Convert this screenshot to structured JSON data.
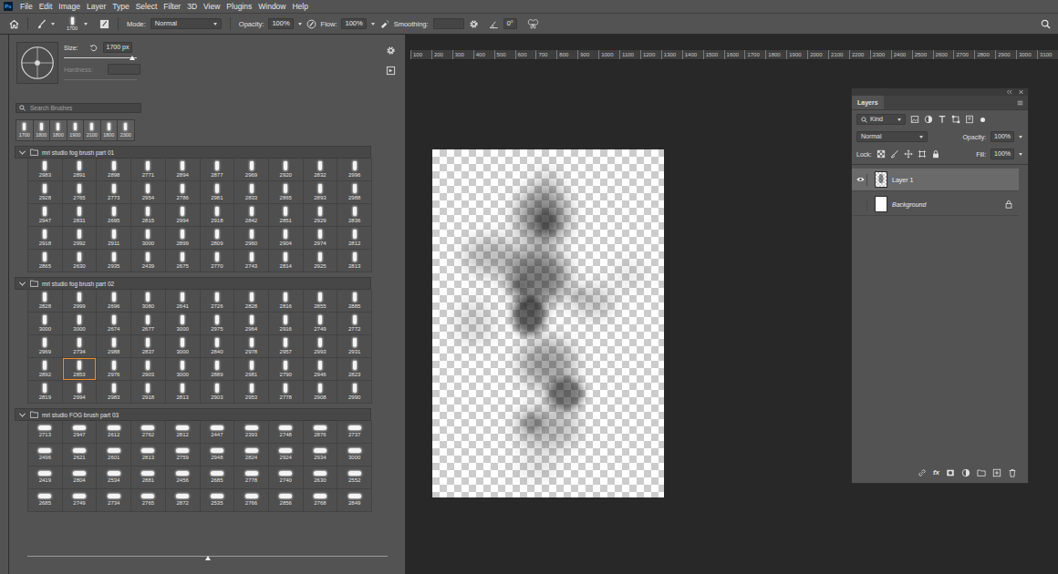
{
  "app": {
    "logo": "Ps"
  },
  "menu": [
    "File",
    "Edit",
    "Image",
    "Layer",
    "Type",
    "Select",
    "Filter",
    "3D",
    "View",
    "Plugins",
    "Window",
    "Help"
  ],
  "options_bar": {
    "brush_size": "1700",
    "mode_label": "Mode:",
    "mode": "Normal",
    "opacity_label": "Opacity:",
    "opacity": "100%",
    "flow_label": "Flow:",
    "flow": "100%",
    "smoothing_label": "Smoothing:",
    "angle": "0°"
  },
  "brush_panel": {
    "size_label": "Size:",
    "size_value": "1700 px",
    "size_level": 0.94,
    "hardness_label": "Hardness:",
    "hardness_disabled": true,
    "search_placeholder": "Search Brushes",
    "recent": [
      {
        "size": "1700",
        "selected": false
      },
      {
        "size": "1800",
        "selected": false
      },
      {
        "size": "1800",
        "selected": false
      },
      {
        "size": "1900",
        "selected": false
      },
      {
        "size": "2100",
        "selected": false
      },
      {
        "size": "1800",
        "selected": false
      },
      {
        "size": "2300",
        "selected": false
      }
    ],
    "groups": [
      {
        "name": "mri studio fog brush part 01",
        "expanded": true,
        "kind": "tall",
        "brushes": [
          {
            "size": "2983",
            "selected": false
          },
          {
            "size": "2891",
            "selected": false
          },
          {
            "size": "2898",
            "selected": false
          },
          {
            "size": "2771",
            "selected": false
          },
          {
            "size": "2894",
            "selected": false
          },
          {
            "size": "2877",
            "selected": false
          },
          {
            "size": "2969",
            "selected": false
          },
          {
            "size": "2920",
            "selected": false
          },
          {
            "size": "2832",
            "selected": false
          },
          {
            "size": "2996",
            "selected": false
          },
          {
            "size": "2928",
            "selected": false
          },
          {
            "size": "2765",
            "selected": false
          },
          {
            "size": "2773",
            "selected": false
          },
          {
            "size": "2954",
            "selected": false
          },
          {
            "size": "2786",
            "selected": false
          },
          {
            "size": "2981",
            "selected": false
          },
          {
            "size": "2833",
            "selected": false
          },
          {
            "size": "2865",
            "selected": false
          },
          {
            "size": "2893",
            "selected": false
          },
          {
            "size": "2988",
            "selected": false
          },
          {
            "size": "2947",
            "selected": false
          },
          {
            "size": "2831",
            "selected": false
          },
          {
            "size": "2695",
            "selected": false
          },
          {
            "size": "2815",
            "selected": false
          },
          {
            "size": "2994",
            "selected": false
          },
          {
            "size": "2918",
            "selected": false
          },
          {
            "size": "2842",
            "selected": false
          },
          {
            "size": "2851",
            "selected": false
          },
          {
            "size": "2929",
            "selected": false
          },
          {
            "size": "2836",
            "selected": false
          },
          {
            "size": "2918",
            "selected": false
          },
          {
            "size": "2992",
            "selected": false
          },
          {
            "size": "2911",
            "selected": false
          },
          {
            "size": "3000",
            "selected": false
          },
          {
            "size": "2899",
            "selected": false
          },
          {
            "size": "2809",
            "selected": false
          },
          {
            "size": "2960",
            "selected": false
          },
          {
            "size": "2904",
            "selected": false
          },
          {
            "size": "2974",
            "selected": false
          },
          {
            "size": "2812",
            "selected": false
          },
          {
            "size": "2865",
            "selected": false
          },
          {
            "size": "2630",
            "selected": false
          },
          {
            "size": "2935",
            "selected": false
          },
          {
            "size": "2439",
            "selected": false
          },
          {
            "size": "2675",
            "selected": false
          },
          {
            "size": "2770",
            "selected": false
          },
          {
            "size": "2743",
            "selected": false
          },
          {
            "size": "2814",
            "selected": false
          },
          {
            "size": "2925",
            "selected": false
          },
          {
            "size": "2813",
            "selected": false
          }
        ]
      },
      {
        "name": "mri studio fog brush part 02",
        "expanded": true,
        "kind": "tall",
        "brushes": [
          {
            "size": "2828",
            "selected": false
          },
          {
            "size": "2999",
            "selected": false
          },
          {
            "size": "2696",
            "selected": false
          },
          {
            "size": "3080",
            "selected": false
          },
          {
            "size": "2641",
            "selected": false
          },
          {
            "size": "2726",
            "selected": false
          },
          {
            "size": "2828",
            "selected": false
          },
          {
            "size": "2816",
            "selected": false
          },
          {
            "size": "2855",
            "selected": false
          },
          {
            "size": "2885",
            "selected": false
          },
          {
            "size": "3000",
            "selected": false
          },
          {
            "size": "3000",
            "selected": false
          },
          {
            "size": "2674",
            "selected": false
          },
          {
            "size": "2677",
            "selected": false
          },
          {
            "size": "3000",
            "selected": false
          },
          {
            "size": "2975",
            "selected": false
          },
          {
            "size": "2964",
            "selected": false
          },
          {
            "size": "2916",
            "selected": false
          },
          {
            "size": "2749",
            "selected": false
          },
          {
            "size": "2772",
            "selected": false
          },
          {
            "size": "2969",
            "selected": false
          },
          {
            "size": "2734",
            "selected": false
          },
          {
            "size": "2988",
            "selected": false
          },
          {
            "size": "2837",
            "selected": false
          },
          {
            "size": "3000",
            "selected": false
          },
          {
            "size": "2840",
            "selected": false
          },
          {
            "size": "2978",
            "selected": false
          },
          {
            "size": "2957",
            "selected": false
          },
          {
            "size": "2993",
            "selected": false
          },
          {
            "size": "2931",
            "selected": false
          },
          {
            "size": "2892",
            "selected": false
          },
          {
            "size": "2853",
            "selected": true
          },
          {
            "size": "2976",
            "selected": false
          },
          {
            "size": "2903",
            "selected": false
          },
          {
            "size": "3000",
            "selected": false
          },
          {
            "size": "2889",
            "selected": false
          },
          {
            "size": "2981",
            "selected": false
          },
          {
            "size": "2790",
            "selected": false
          },
          {
            "size": "2946",
            "selected": false
          },
          {
            "size": "2823",
            "selected": false
          },
          {
            "size": "2819",
            "selected": false
          },
          {
            "size": "2994",
            "selected": false
          },
          {
            "size": "2983",
            "selected": false
          },
          {
            "size": "2918",
            "selected": false
          },
          {
            "size": "2813",
            "selected": false
          },
          {
            "size": "2903",
            "selected": false
          },
          {
            "size": "2953",
            "selected": false
          },
          {
            "size": "2778",
            "selected": false
          },
          {
            "size": "2908",
            "selected": false
          },
          {
            "size": "2990",
            "selected": false
          }
        ]
      },
      {
        "name": "mri studio FOG brush part 03",
        "expanded": true,
        "kind": "wide",
        "brushes": [
          {
            "size": "2713",
            "selected": false
          },
          {
            "size": "2947",
            "selected": false
          },
          {
            "size": "2612",
            "selected": false
          },
          {
            "size": "2762",
            "selected": false
          },
          {
            "size": "2812",
            "selected": false
          },
          {
            "size": "2447",
            "selected": false
          },
          {
            "size": "2393",
            "selected": false
          },
          {
            "size": "2748",
            "selected": false
          },
          {
            "size": "2876",
            "selected": false
          },
          {
            "size": "2737",
            "selected": false
          },
          {
            "size": "2496",
            "selected": false
          },
          {
            "size": "2621",
            "selected": false
          },
          {
            "size": "2601",
            "selected": false
          },
          {
            "size": "2813",
            "selected": false
          },
          {
            "size": "2759",
            "selected": false
          },
          {
            "size": "2948",
            "selected": false
          },
          {
            "size": "2824",
            "selected": false
          },
          {
            "size": "2924",
            "selected": false
          },
          {
            "size": "2934",
            "selected": false
          },
          {
            "size": "3000",
            "selected": false
          },
          {
            "size": "2419",
            "selected": false
          },
          {
            "size": "2804",
            "selected": false
          },
          {
            "size": "2534",
            "selected": false
          },
          {
            "size": "2881",
            "selected": false
          },
          {
            "size": "2456",
            "selected": false
          },
          {
            "size": "2685",
            "selected": false
          },
          {
            "size": "2778",
            "selected": false
          },
          {
            "size": "2740",
            "selected": false
          },
          {
            "size": "2630",
            "selected": false
          },
          {
            "size": "2552",
            "selected": false
          },
          {
            "size": "2685",
            "selected": false
          },
          {
            "size": "2749",
            "selected": false
          },
          {
            "size": "2734",
            "selected": false
          },
          {
            "size": "2765",
            "selected": false
          },
          {
            "size": "2872",
            "selected": false
          },
          {
            "size": "2535",
            "selected": false
          },
          {
            "size": "2766",
            "selected": false
          },
          {
            "size": "2856",
            "selected": false
          },
          {
            "size": "2768",
            "selected": false
          },
          {
            "size": "2849",
            "selected": false
          }
        ]
      }
    ],
    "thumb_size_level": 0.5
  },
  "ruler": [
    "100",
    "200",
    "300",
    "400",
    "500",
    "600",
    "700",
    "800",
    "900",
    "1000",
    "1100",
    "1200",
    "1300",
    "1400",
    "1500",
    "1600",
    "1700",
    "1800",
    "1900",
    "2000",
    "2100",
    "2200",
    "2300",
    "2400",
    "2500",
    "2600",
    "2700",
    "2800",
    "2900",
    "3000",
    "3100"
  ],
  "layers_panel": {
    "title": "Layers",
    "filter": "Kind",
    "blend_mode": "Normal",
    "opacity_label": "Opacity:",
    "opacity": "100%",
    "lock_label": "Lock:",
    "fill_label": "Fill:",
    "fill": "100%",
    "fx_label": "fx",
    "layers": [
      {
        "name": "Layer 1",
        "kind": "pixels",
        "visible": true,
        "selected": true,
        "locked": false
      },
      {
        "name": "Background",
        "kind": "background",
        "visible": false,
        "selected": false,
        "locked": true
      }
    ]
  }
}
